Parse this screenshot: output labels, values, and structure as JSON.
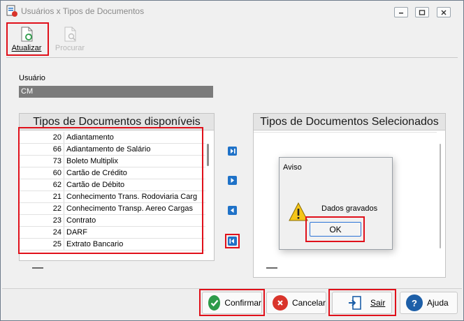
{
  "window": {
    "title": "Usuários x Tipos de Documentos",
    "controls": {
      "minimize_icon": "minimize-icon",
      "maximize_icon": "maximize-icon",
      "close_icon": "close-icon"
    }
  },
  "toolbar": {
    "refresh": {
      "label": "Atualizar",
      "icon": "refresh-document-icon"
    },
    "search": {
      "label": "Procurar",
      "icon": "search-document-icon"
    }
  },
  "user": {
    "label": "Usuário",
    "value": "CM"
  },
  "available": {
    "header": "Tipos de Documentos disponíveis",
    "rows": [
      {
        "code": "20",
        "name": "Adiantamento"
      },
      {
        "code": "66",
        "name": "Adiantamento de Salário"
      },
      {
        "code": "73",
        "name": "Boleto Multiplix"
      },
      {
        "code": "60",
        "name": "Cartão de Crédito"
      },
      {
        "code": "62",
        "name": "Cartão de Débito"
      },
      {
        "code": "21",
        "name": "Conhecimento Trans. Rodoviaria Carg"
      },
      {
        "code": "22",
        "name": "Conhecimento Transp. Aereo Cargas"
      },
      {
        "code": "23",
        "name": "Contrato"
      },
      {
        "code": "24",
        "name": "DARF"
      },
      {
        "code": "25",
        "name": "Extrato Bancario"
      }
    ]
  },
  "selected": {
    "header": "Tipos de Documentos Selecionados"
  },
  "move_buttons": {
    "add_all_icon": "move-all-right-icon",
    "add_icon": "move-right-icon",
    "remove_icon": "move-left-icon",
    "remove_all_icon": "move-all-left-icon"
  },
  "dialog": {
    "title": "Aviso",
    "message": "Dados gravados",
    "icon": "warning-icon",
    "ok_label": "OK"
  },
  "buttons": {
    "confirm": "Confirmar",
    "cancel": "Cancelar",
    "exit": "Sair",
    "help": "Ajuda"
  },
  "colors": {
    "highlight": "#e0101a",
    "confirm_green": "#2e9b4a",
    "cancel_red": "#d9342b",
    "help_blue": "#1d5fa8",
    "arrow_blue": "#1f72c8"
  }
}
